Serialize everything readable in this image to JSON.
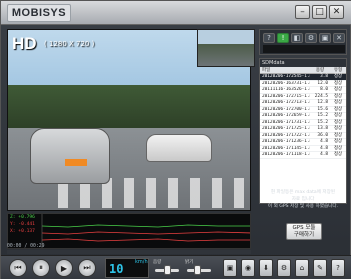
{
  "app": {
    "logo": "MOBISYS"
  },
  "window": {
    "buttons": [
      {
        "name": "minimize",
        "glyph": "–"
      },
      {
        "name": "maximize",
        "glyph": "□"
      },
      {
        "name": "close",
        "glyph": "✕"
      }
    ]
  },
  "video": {
    "quality": "HD",
    "resolution": "( 1280 X 720 )"
  },
  "map": {
    "icons": [
      {
        "glyph": "?",
        "green": false
      },
      {
        "glyph": "!",
        "green": true
      },
      {
        "glyph": "◧",
        "green": false
      },
      {
        "glyph": "⚙",
        "green": false
      },
      {
        "glyph": "▣",
        "green": false
      },
      {
        "glyph": "✕",
        "green": false
      }
    ]
  },
  "filelist": {
    "panel_title": "SDMdata",
    "columns": [
      "파일",
      "용량",
      "유형"
    ],
    "rows": [
      {
        "name": "20120206-172545-1.mx",
        "size": "3.8",
        "type": "정상",
        "selected": true
      },
      {
        "name": "20120206-163731-1.mx",
        "size": "12.0",
        "type": "정상",
        "selected": false
      },
      {
        "name": "20111116-163526-1.mx",
        "size": "8.0",
        "type": "정상",
        "selected": false
      },
      {
        "name": "20120206-172715-1.mx",
        "size": "224.5",
        "type": "정상",
        "selected": false
      },
      {
        "name": "20120206-172713-1.mx",
        "size": "12.8",
        "type": "정상",
        "selected": false
      },
      {
        "name": "20120206-172700-1.mx",
        "size": "15.6",
        "type": "정상",
        "selected": false
      },
      {
        "name": "20120206-172659-1.mx",
        "size": "15.2",
        "type": "정상",
        "selected": false
      },
      {
        "name": "20120206-171731-1.mx",
        "size": "15.2",
        "type": "정상",
        "selected": false
      },
      {
        "name": "20120206-171725-1.mx",
        "size": "13.8",
        "type": "정상",
        "selected": false
      },
      {
        "name": "20120206-171722-1.mx",
        "size": "36.0",
        "type": "정상",
        "selected": false
      },
      {
        "name": "20120206-171236-1.mx",
        "size": "4.8",
        "type": "정상",
        "selected": false
      },
      {
        "name": "20120206-171145-1.mx",
        "size": "4.8",
        "type": "정상",
        "selected": false
      },
      {
        "name": "20120206-171118-1.mx",
        "size": "4.8",
        "type": "정상",
        "selected": false
      }
    ],
    "notice_lines": [
      "현 파일등은 max data에 저장된",
      "자료 입니다",
      "이 외 GPS 저장 및 사용 하였습니다."
    ]
  },
  "gps_button": {
    "line1": "GPS 모듈",
    "line2": "구매하기"
  },
  "graph": {
    "axis": [
      {
        "label": "Z: +0.796",
        "color": "#4ad14a"
      },
      {
        "label": "Y: -0.441",
        "color": "#e84040"
      },
      {
        "label": "X: +0.137",
        "color": "#e84040"
      },
      {
        "label": "",
        "color": "#e84040"
      }
    ],
    "timestamp": "00:00 / 00:29"
  },
  "controls": {
    "play_buttons": [
      {
        "name": "previous",
        "glyph": "⏮"
      },
      {
        "name": "pause",
        "glyph": "⏸"
      },
      {
        "name": "play",
        "glyph": "▶"
      },
      {
        "name": "next",
        "glyph": "⏭"
      }
    ],
    "speed_value": "10",
    "speed_unit": "km/h",
    "sliders": [
      {
        "name": "volume",
        "label": "음량",
        "level": 0.5
      },
      {
        "name": "brightness",
        "label": "밝기",
        "level": 0.4
      }
    ],
    "right_buttons": [
      {
        "name": "screen-mode",
        "glyph": "▣",
        "label": "화면전환"
      },
      {
        "name": "capture",
        "glyph": "◉",
        "label": "캡쳐"
      },
      {
        "name": "open",
        "glyph": "⬇",
        "label": "파일열기"
      },
      {
        "name": "settings",
        "glyph": "⚙",
        "label": "설정"
      },
      {
        "name": "home",
        "glyph": "⌂",
        "label": "홈"
      },
      {
        "name": "print",
        "glyph": "✎",
        "label": "프린트"
      },
      {
        "name": "help",
        "glyph": "?",
        "label": "도움"
      }
    ]
  }
}
